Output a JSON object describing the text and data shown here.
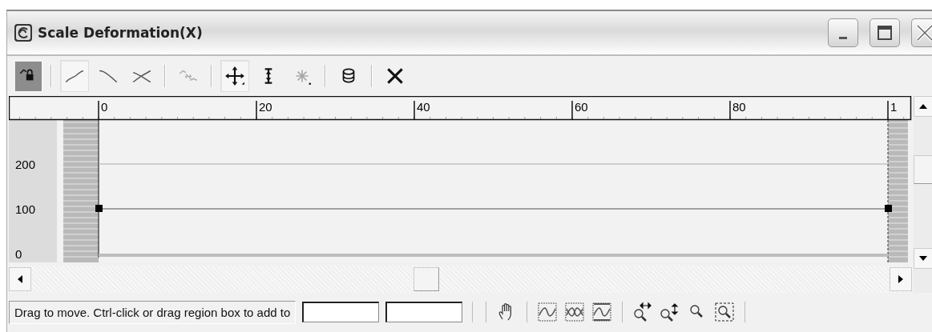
{
  "window": {
    "title": "Scale Deformation(X)"
  },
  "toolbar": {
    "groups": [
      [
        {
          "kind": "lock",
          "selected": true,
          "disabled": false
        }
      ],
      [
        {
          "kind": "x-curve",
          "selected": true,
          "disabled": false
        },
        {
          "kind": "y-curve",
          "selected": false,
          "disabled": false
        },
        {
          "kind": "xy-curve",
          "selected": false,
          "disabled": false
        }
      ],
      [
        {
          "kind": "swap",
          "selected": false,
          "disabled": true
        }
      ],
      [
        {
          "kind": "move",
          "selected": true,
          "disabled": false
        },
        {
          "kind": "scale",
          "selected": false,
          "disabled": false
        },
        {
          "kind": "insert",
          "selected": false,
          "disabled": true
        }
      ],
      [
        {
          "kind": "delete",
          "selected": false,
          "disabled": false
        }
      ],
      [
        {
          "kind": "reset",
          "selected": false,
          "disabled": false
        }
      ]
    ]
  },
  "graph": {
    "ruler_labels": [
      "0",
      "20",
      "40",
      "60",
      "80",
      "1"
    ],
    "value_labels": [
      "200",
      "100",
      "0"
    ]
  },
  "status_bar": {
    "prompt": "Drag to move. Ctrl-click or drag region box to add to"
  }
}
